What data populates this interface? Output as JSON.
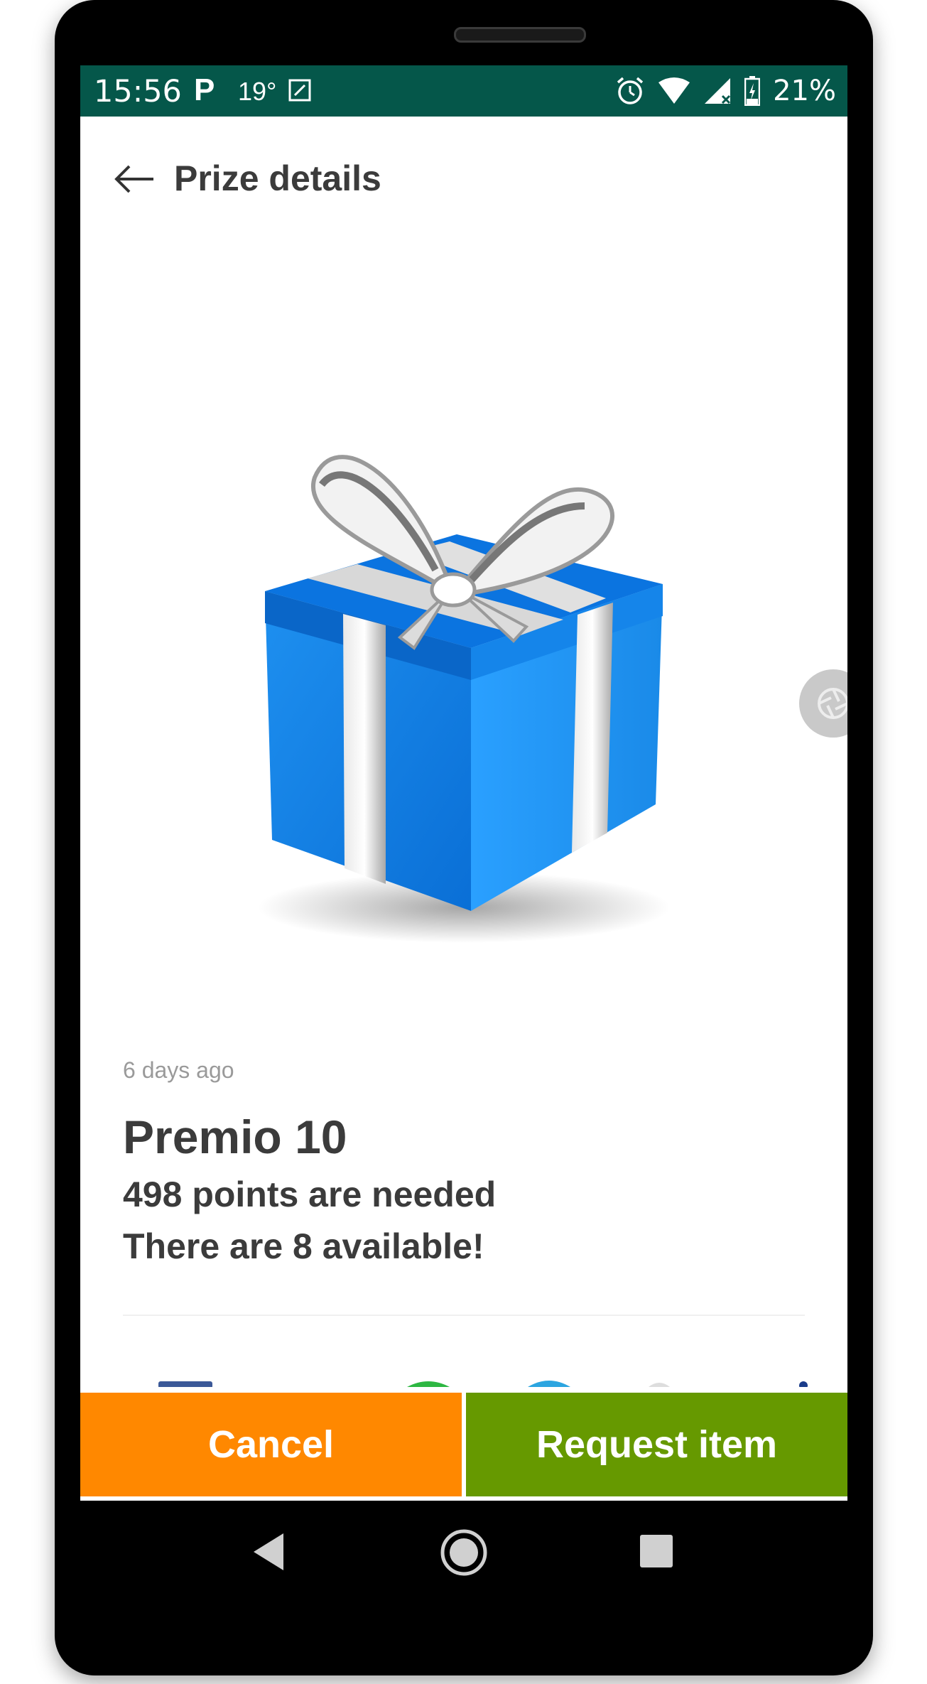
{
  "status_bar": {
    "time": "15:56",
    "p_icon": "P",
    "temperature": "19°",
    "battery_percent": "21%",
    "icons": [
      "edit-icon",
      "alarm-icon",
      "wifi-icon",
      "signal-icon",
      "battery-icon"
    ],
    "background_color": "#05574a"
  },
  "app_bar": {
    "title": "Prize details",
    "back_icon": "arrow-left-icon"
  },
  "prize": {
    "image_icon": "gift-box-icon",
    "posted": "6 days ago",
    "name": "Premio 10",
    "points_needed": "498 points are needed",
    "availability": "There are 8 available!"
  },
  "floating_button": {
    "icon": "camera-shutter-icon"
  },
  "actions": {
    "cancel_label": "Cancel",
    "request_label": "Request item",
    "cancel_color": "#ff8800",
    "request_color": "#669900"
  },
  "nav_bar": {
    "icons": [
      "nav-back-icon",
      "nav-home-icon",
      "nav-recent-icon"
    ]
  }
}
